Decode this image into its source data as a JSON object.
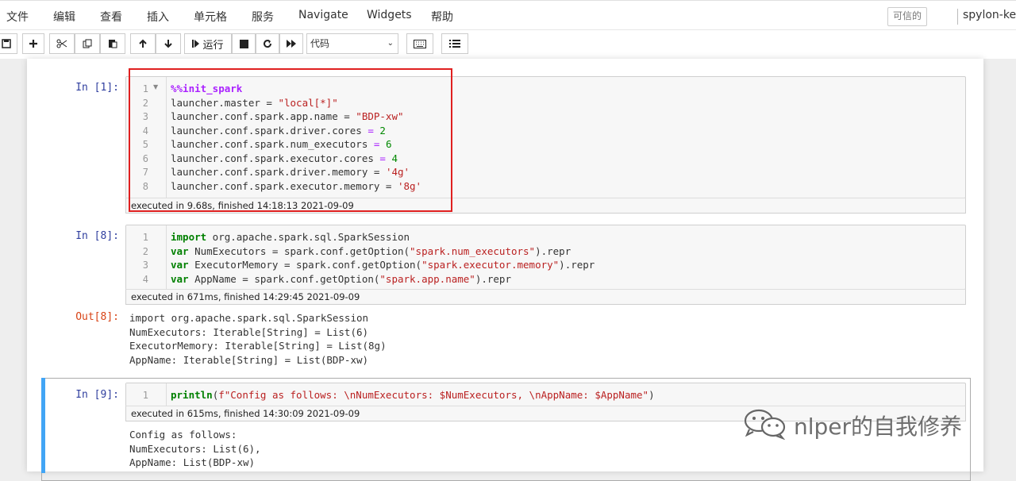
{
  "menubar": {
    "items": [
      "文件",
      "编辑",
      "查看",
      "插入",
      "单元格",
      "服务",
      "Navigate",
      "Widgets",
      "帮助"
    ],
    "trusted_label": "可信的",
    "kernel_name": "spylon-kern"
  },
  "toolbar": {
    "run_label": "运行",
    "cell_type": "代码"
  },
  "cells": [
    {
      "prompt": "In  [1]:",
      "lines": [
        "%%init_spark",
        "launcher.master = \"local[*]\"",
        "launcher.conf.spark.app.name = \"BDP-xw\"",
        "launcher.conf.spark.driver.cores = 2",
        "launcher.conf.spark.num_executors = 6",
        "launcher.conf.spark.executor.cores = 4",
        "launcher.conf.spark.driver.memory = '4g'",
        "launcher.conf.spark.executor.memory = '8g'"
      ],
      "exec_info": "executed in 9.68s, finished 14:18:13 2021-09-09"
    },
    {
      "prompt": "In  [8]:",
      "lines": [
        "import org.apache.spark.sql.SparkSession",
        "var NumExecutors = spark.conf.getOption(\"spark.num_executors\").repr",
        "var ExecutorMemory = spark.conf.getOption(\"spark.executor.memory\").repr",
        "var AppName = spark.conf.getOption(\"spark.app.name\").repr"
      ],
      "exec_info": "executed in 671ms, finished 14:29:45 2021-09-09",
      "out_prompt": "Out[8]:",
      "output": [
        "import org.apache.spark.sql.SparkSession",
        "NumExecutors: Iterable[String] = List(6)",
        "ExecutorMemory: Iterable[String] = List(8g)",
        "AppName: Iterable[String] = List(BDP-xw)"
      ]
    },
    {
      "prompt": "In  [9]:",
      "lines": [
        "println(f\"Config as follows: \\nNumExecutors: $NumExecutors, \\nAppName: $AppName\")"
      ],
      "exec_info": "executed in 615ms, finished 14:30:09 2021-09-09",
      "output": [
        "Config as follows:",
        "NumExecutors: List(6),",
        "AppName: List(BDP-xw)"
      ]
    }
  ],
  "watermark": "nlper的自我修养"
}
